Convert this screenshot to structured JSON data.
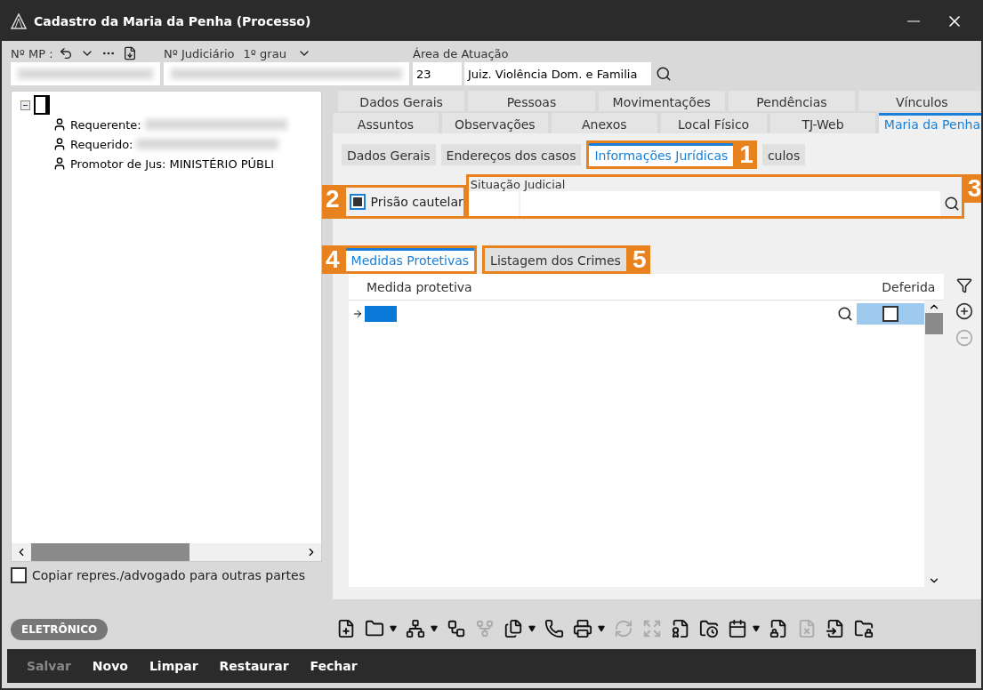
{
  "window": {
    "title": "Cadastro da Maria da Penha (Processo)"
  },
  "header": {
    "mp_label": "Nº MP :",
    "judicial_label": "Nº Judiciário",
    "grau": "1º grau",
    "area_label": "Área de Atuação",
    "area_code": "23",
    "area_name": "Juiz. Violência Dom. e Familia"
  },
  "tree": {
    "expanded": true,
    "children": [
      {
        "label": "Requerente:",
        "blurred": true
      },
      {
        "label": "Requerido:",
        "blurred": true
      },
      {
        "label": "Promotor de Jus: MINISTÉRIO PÚBLI",
        "blurred": false
      }
    ]
  },
  "copy_checkbox": {
    "label": "Copiar repres./advogado para outras partes",
    "checked": false
  },
  "badge": "ELETRÔNICO",
  "tabs_row1": [
    {
      "label": "Dados Gerais",
      "selected": false
    },
    {
      "label": "Pessoas",
      "selected": false
    },
    {
      "label": "Movimentações",
      "selected": false
    },
    {
      "label": "Pendências",
      "selected": false
    },
    {
      "label": "Vínculos",
      "selected": false
    }
  ],
  "tabs_row2": [
    {
      "label": "Assuntos",
      "selected": false
    },
    {
      "label": "Observações",
      "selected": false
    },
    {
      "label": "Anexos",
      "selected": false
    },
    {
      "label": "Local Físico",
      "selected": false
    },
    {
      "label": "TJ-Web",
      "selected": false
    },
    {
      "label": "Maria da Penha",
      "selected": true
    }
  ],
  "subtabs": [
    {
      "label": "Dados Gerais",
      "selected": false
    },
    {
      "label": "Endereços dos casos",
      "selected": false
    },
    {
      "label": "Informações Jurídicas",
      "selected": true,
      "callout": "1"
    },
    {
      "label": "culos",
      "selected": false
    }
  ],
  "prisao": {
    "label": "Prisão cautelar",
    "checked": true,
    "callout": "2"
  },
  "situacao": {
    "label": "Situação Judicial",
    "callout": "3"
  },
  "inner_tabs": [
    {
      "label": "Medidas Protetivas",
      "selected": true,
      "callout": "4"
    },
    {
      "label": "Listagem dos Crimes",
      "selected": false,
      "callout": "5"
    }
  ],
  "grid": {
    "columns": [
      "Medida protetiva",
      "Deferida"
    ],
    "rows": [
      {
        "current": true,
        "deferida": false
      }
    ]
  },
  "side_buttons": [
    {
      "kind": "add",
      "disabled": false
    },
    {
      "kind": "remove",
      "disabled": true
    }
  ],
  "toolbar": [
    {
      "disabled": false,
      "dropdown": false
    },
    {
      "disabled": false,
      "dropdown": true
    },
    {
      "disabled": false,
      "dropdown": true
    },
    {
      "disabled": false,
      "dropdown": false
    },
    {
      "disabled": true,
      "dropdown": false
    },
    {
      "disabled": false,
      "dropdown": true
    },
    {
      "disabled": false,
      "dropdown": false
    },
    {
      "disabled": false,
      "dropdown": true
    },
    {
      "disabled": true,
      "dropdown": false
    },
    {
      "disabled": true,
      "dropdown": false
    },
    {
      "disabled": false,
      "dropdown": false
    },
    {
      "disabled": false,
      "dropdown": false
    },
    {
      "disabled": false,
      "dropdown": true
    },
    {
      "disabled": false,
      "dropdown": false
    },
    {
      "disabled": true,
      "dropdown": false
    },
    {
      "disabled": false,
      "dropdown": false
    },
    {
      "disabled": false,
      "dropdown": false
    }
  ],
  "actions": [
    {
      "label": "Salvar",
      "disabled": true
    },
    {
      "label": "Novo",
      "disabled": false
    },
    {
      "label": "Limpar",
      "disabled": false
    },
    {
      "label": "Restaurar",
      "disabled": false
    },
    {
      "label": "Fechar",
      "disabled": false
    }
  ]
}
